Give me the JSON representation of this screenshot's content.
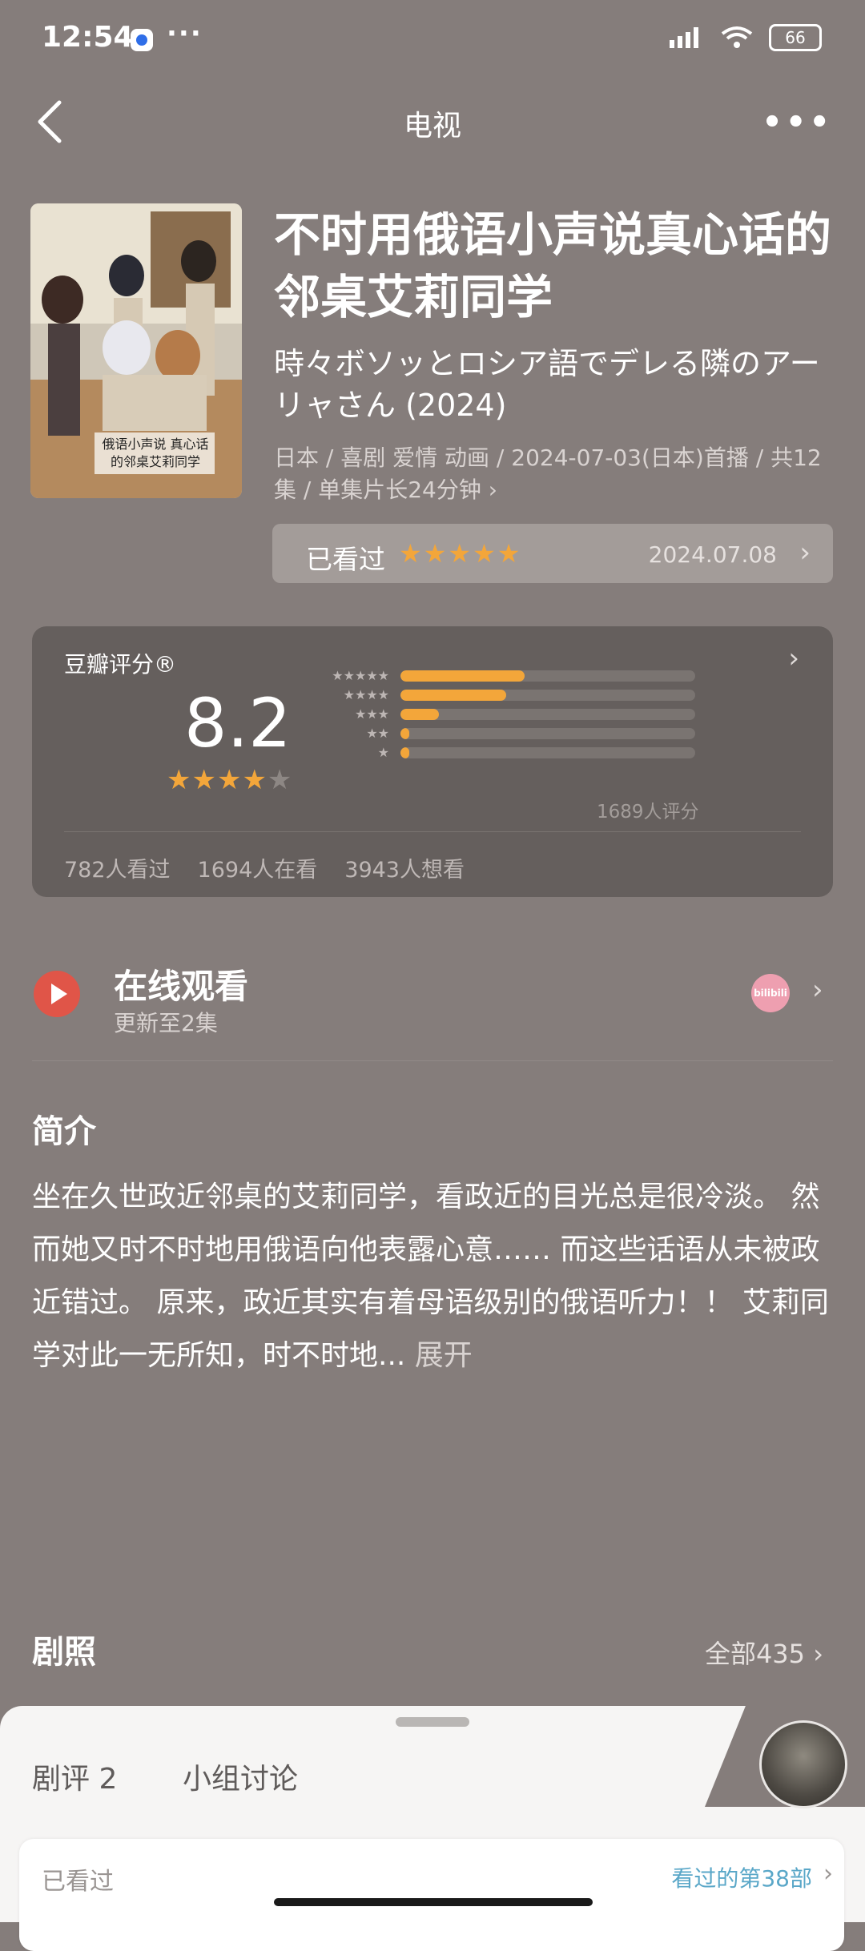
{
  "status": {
    "time": "12:54",
    "battery": "66"
  },
  "nav": {
    "title": "电视"
  },
  "show": {
    "title": "不时用俄语小声说真心话的邻桌艾莉同学",
    "subtitle": "時々ボソッとロシア語でデレる隣のアーリャさん (2024)",
    "meta": "日本 / 喜剧 爱情 动画 / 2024-07-03(日本)首播 / 共12集 / 单集片长24分钟 ›",
    "watched_label": "已看过",
    "watched_stars": "★★★★★",
    "watched_date": "2024.07.08"
  },
  "rating": {
    "title": "豆瓣评分®",
    "score": "8.2",
    "stars": "★★★★★",
    "stars_filled": 4,
    "distribution": [
      {
        "stars": "★★★★★",
        "fraction": 0.42
      },
      {
        "stars": "★★★★",
        "fraction": 0.36
      },
      {
        "stars": "★★★",
        "fraction": 0.13
      },
      {
        "stars": "★★",
        "fraction": 0.02
      },
      {
        "stars": "★",
        "fraction": 0.03
      }
    ],
    "count": "1689人评分",
    "watched": "782人看过",
    "watching": "1694人在看",
    "want": "3943人想看"
  },
  "online": {
    "title": "在线观看",
    "sub": "更新至2集",
    "provider": "bilibili"
  },
  "intro": {
    "title": "简介",
    "text": "坐在久世政近邻桌的艾莉同学，看政近的目光总是很冷淡。 然而她又时不时地用俄语向他表露心意…… 而这些话语从未被政近错过。 原来，政近其实有着母语级别的俄语听力！！ 艾莉同学对此一无所知，时不时地...",
    "expand": "展开"
  },
  "stills": {
    "title": "剧照",
    "all": "全部435"
  },
  "sheet": {
    "tab_reviews": "剧评 2",
    "tab_group": "小组讨论",
    "card_left": "已看过",
    "card_right": "看过的第38部"
  },
  "colors": {
    "accent": "#f3a63a",
    "background": "#857d7b",
    "play": "#e05548"
  }
}
